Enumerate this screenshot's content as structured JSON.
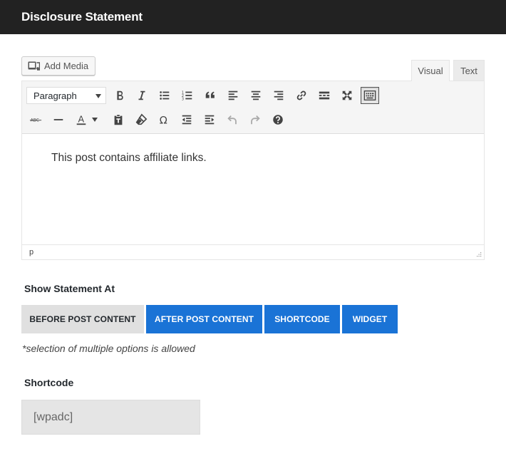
{
  "header": {
    "title": "Disclosure Statement"
  },
  "editor": {
    "add_media_label": "Add Media",
    "tabs": {
      "visual": "Visual",
      "text": "Text"
    },
    "format_select_value": "Paragraph",
    "toolbar_row1_icons": [
      "bold-icon",
      "italic-icon",
      "bullet-list-icon",
      "numbered-list-icon",
      "blockquote-icon",
      "align-left-icon",
      "align-center-icon",
      "align-right-icon",
      "link-icon",
      "read-more-icon",
      "fullscreen-icon",
      "toolbar-toggle-icon"
    ],
    "toolbar_row2_icons": [
      "strikethrough-icon",
      "horizontal-line-icon",
      "text-color-icon",
      "paste-as-text-icon",
      "clear-formatting-icon",
      "special-character-icon",
      "outdent-icon",
      "indent-icon",
      "undo-icon",
      "redo-icon",
      "help-icon"
    ],
    "strikethrough_glyph": "ABC",
    "text_color_glyph": "A",
    "omega_glyph": "Ω",
    "content_text": "This post contains affiliate links.",
    "path_label": "p"
  },
  "show_statement": {
    "label": "Show Statement At",
    "options": [
      {
        "label": "BEFORE POST CONTENT",
        "selected": false
      },
      {
        "label": "AFTER POST CONTENT",
        "selected": true
      },
      {
        "label": "SHORTCODE",
        "selected": true
      },
      {
        "label": "WIDGET",
        "selected": true
      }
    ],
    "note": "*selection of multiple options is allowed"
  },
  "shortcode": {
    "label": "Shortcode",
    "value": "[wpadc]"
  },
  "colors": {
    "header_bg": "#222222",
    "selected_option": "#1a73d6",
    "unselected_option": "#e0e0e0"
  }
}
